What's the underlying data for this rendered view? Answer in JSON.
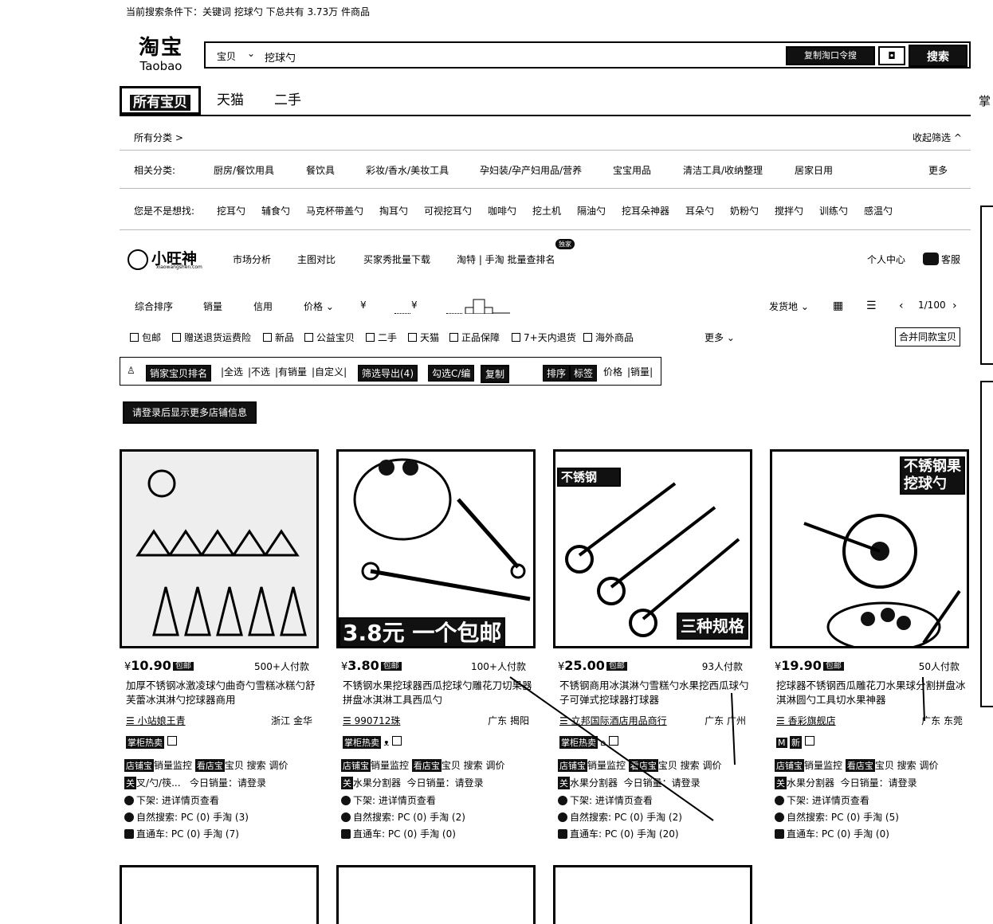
{
  "summary": "当前搜索条件下：关键词 挖球勺 下总共有 3.73万 件商品",
  "logo": {
    "cn": "淘宝",
    "en": "Taobao"
  },
  "search": {
    "category": "宝贝",
    "keyword": "挖球勺",
    "image_search_label": "复制淘口令搜",
    "search_button": "搜索"
  },
  "tabs": [
    {
      "label": "所有宝贝"
    },
    {
      "label": "天猫"
    },
    {
      "label": "二手"
    }
  ],
  "side_char": "掌",
  "filters": {
    "all_categories": "所有分类 >",
    "collapse": "收起筛选 ^",
    "related_label": "相关分类:",
    "related": [
      "厨房/餐饮用具",
      "餐饮具",
      "彩妆/香水/美妆工具",
      "孕妇装/孕产妇用品/营养",
      "宝宝用品",
      "清洁工具/收纳整理",
      "居家日用"
    ],
    "more": "更多",
    "suggest_label": "您是不是想找:",
    "suggest": [
      "挖耳勺",
      "辅食勺",
      "马克杯带盖勺",
      "掏耳勺",
      "可视挖耳勺",
      "咖啡勺",
      "挖土机",
      "隔油勺",
      "挖耳朵神器",
      "耳朵勺",
      "奶粉勺",
      "搅拌勺",
      "训练勺",
      "感温勺"
    ]
  },
  "plugin": {
    "name": "小旺神",
    "domain": "xiaowangshen.com",
    "nav": [
      "市场分析",
      "主图对比",
      "买家秀批量下载",
      "淘特 | 手淘 批量查排名"
    ],
    "new_badge": "独家",
    "account": "个人中心",
    "service": "客服"
  },
  "sort": {
    "items": [
      "综合排序",
      "销量",
      "信用",
      "价格"
    ],
    "currency1": "¥",
    "currency2": "¥",
    "ship_from": "发货地",
    "page": "1/100"
  },
  "checks": [
    "包邮",
    "赠送退货运费险",
    "新品",
    "公益宝贝",
    "二手",
    "天猫",
    "正品保障",
    "7+天内退货",
    "海外商品"
  ],
  "checks_more": "更多",
  "merge_button": "合并同款宝贝",
  "toolbar": {
    "batch": "销家宝贝排名",
    "select": [
      "全选",
      "不选",
      "有销量",
      "自定义"
    ],
    "export": "筛选导出(4)",
    "copy": "勾选C/编",
    "reorder": "复制",
    "sort_by": "排序",
    "trend": "标签",
    "price": "价格",
    "sales": "销量"
  },
  "seller_button": "请登录后显示更多店铺信息",
  "products": [
    {
      "price": "10.90",
      "paid": "500+人付款",
      "title": "加厚不锈钢冰激凌球勺曲奇勺雪糕冰糕勺舒芙蕾冰淇淋勺挖球器商用",
      "shop": "小站娘王青",
      "loc": "浙江 金华",
      "overlay": "",
      "keyword_line": "叉/勺/筷...",
      "today_sales": "今日销量：请登录",
      "organic": "自然搜索: PC (0) 手淘 (3)",
      "ads": "直通车: PC (0) 手淘 (7)"
    },
    {
      "price": "3.80",
      "paid": "100+人付款",
      "title": "不锈钢水果挖球器西瓜挖球勺雕花刀切果器拼盘冰淇淋工具西瓜勺",
      "shop": "990712珠",
      "loc": "广东 揭阳",
      "overlay": "3.8元 一个包邮",
      "keyword_line": "水果分割器",
      "today_sales": "今日销量：请登录",
      "organic": "自然搜索: PC (0) 手淘 (2)",
      "ads": "直通车: PC (0) 手淘 (0)"
    },
    {
      "price": "25.00",
      "paid": "93人付款",
      "title": "不锈钢商用冰淇淋勺雪糕勺水果挖西瓜球勺子可弹式挖球器打球器",
      "shop": "立邦国际酒店用品商行",
      "loc": "广东 广州",
      "overlay": "三种规格",
      "keyword_line": "水果分割器",
      "today_sales": "今日销量：请登录",
      "organic": "自然搜索: PC (0) 手淘 (2)",
      "ads": "直通车: PC (0) 手淘 (20)"
    },
    {
      "price": "19.90",
      "paid": "50人付款",
      "title": "挖球器不锈钢西瓜雕花刀水果球分割拼盘冰淇淋圆勺工具切水果神器",
      "shop": "香彩旗舰店",
      "loc": "广东 东莞",
      "overlay": "不锈钢果挖球勺",
      "keyword_line": "水果分割器",
      "today_sales": "今日销量：请登录",
      "organic": "自然搜索: PC (0) 手淘 (5)",
      "ads": "直通车: PC (0) 手淘 (0)"
    }
  ],
  "card_labels": {
    "free_ship": "包邮",
    "hot": "掌柜热卖",
    "monitor": "店铺宝",
    "monitor_text": "销量监控",
    "sales_tool": "看店宝",
    "sales_tool_text": "宝贝 搜索 调价",
    "kw_tag": "关",
    "offline": "下架:",
    "offline_text": "进详情页查看"
  }
}
